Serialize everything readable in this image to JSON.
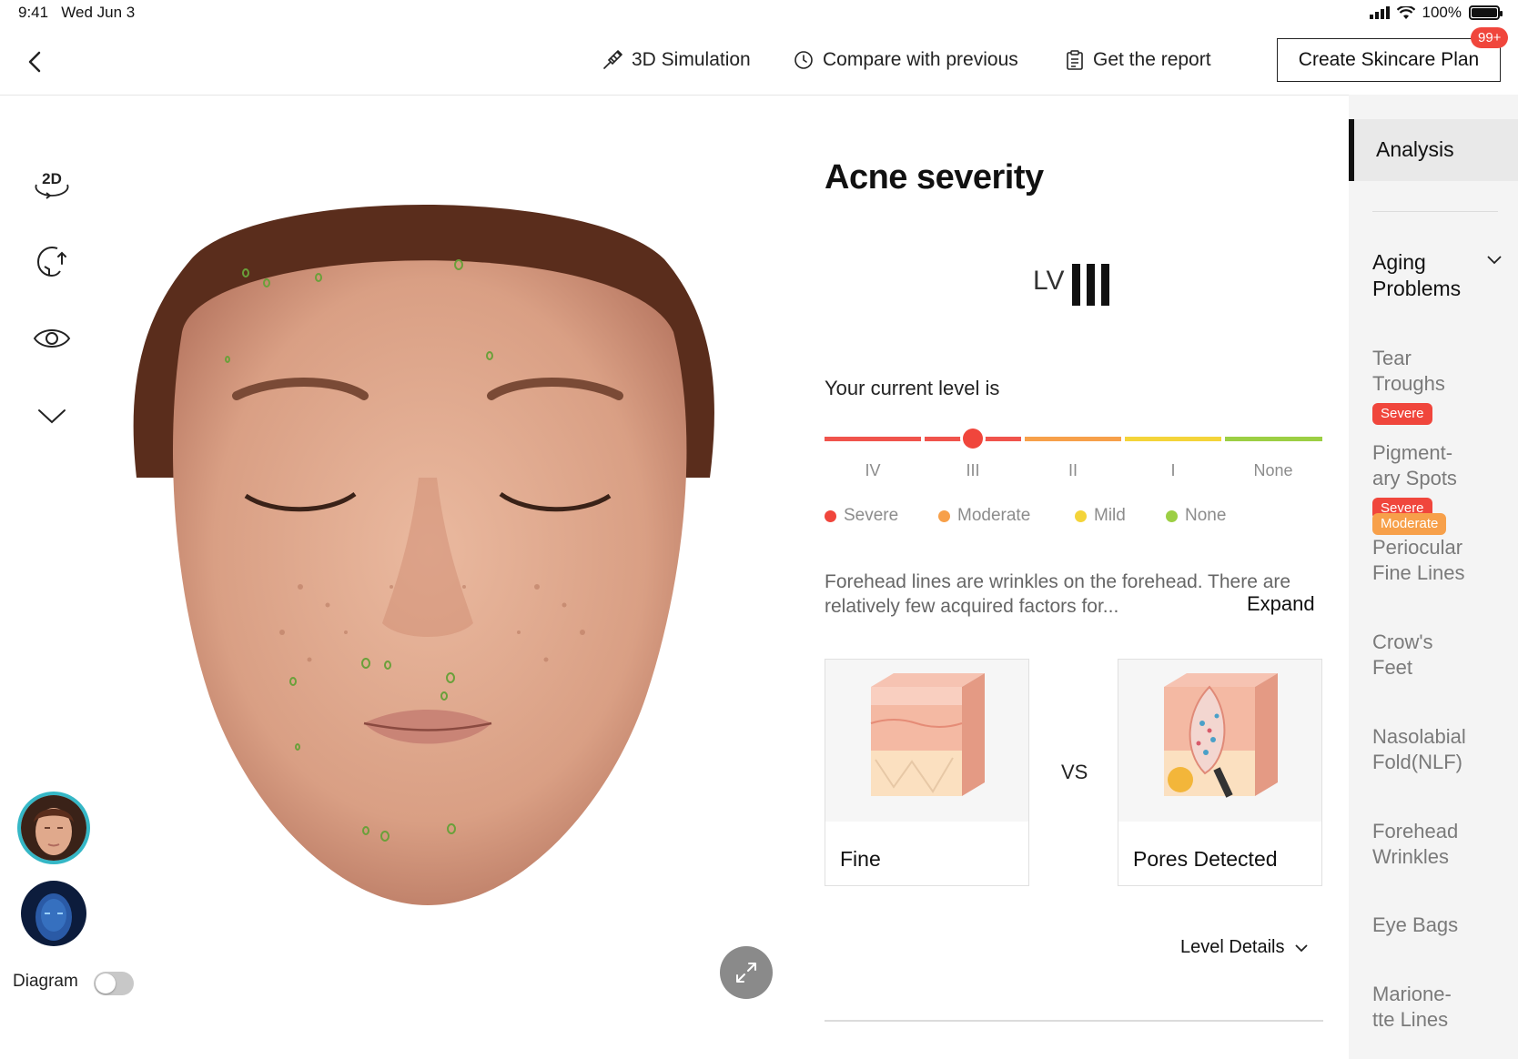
{
  "status": {
    "time": "9:41",
    "date": "Wed Jun 3",
    "battery": "100%",
    "battery_level": 1.0
  },
  "topbar": {
    "simulation_label": "3D Simulation",
    "compare_label": "Compare with previous",
    "report_label": "Get the report",
    "create_label": "Create Skincare Plan",
    "badge": "99+"
  },
  "left_tools": {
    "view_mode_label": "2D",
    "diagram_label": "Diagram",
    "diagram_on": false
  },
  "analysis": {
    "title": "Acne severity",
    "lv_prefix": "LV",
    "level_value": 3,
    "level_label": "Your current level is",
    "scale": [
      {
        "label": "IV",
        "color": "#f0544c"
      },
      {
        "label": "III",
        "color": "#f0544c"
      },
      {
        "label": "II",
        "color": "#f7a04a"
      },
      {
        "label": "I",
        "color": "#f4d43a"
      },
      {
        "label": "None",
        "color": "#9ccf44"
      }
    ],
    "legend": [
      {
        "label": "Severe",
        "color": "#f0463c"
      },
      {
        "label": "Moderate",
        "color": "#f7a04a"
      },
      {
        "label": "Mild",
        "color": "#f4d43a"
      },
      {
        "label": "None",
        "color": "#9ccf44"
      }
    ],
    "description": "Forehead lines are wrinkles on the forehead. There are relatively few acquired factors for...",
    "expand_label": "Expand",
    "card_left_label": "Fine",
    "vs_label": "VS",
    "card_right_label": "Pores Detected",
    "level_details_label": "Level Details"
  },
  "sidebar": {
    "active_tab": "Analysis",
    "group_title": "Aging Problems",
    "items": [
      {
        "label": "Tear Troughs"
      },
      {
        "label": "Pigment-ary Spots"
      },
      {
        "label": "Periocular Fine Lines"
      },
      {
        "label": "Crow's Feet"
      },
      {
        "label": "Nasolabial Fold(NLF)"
      },
      {
        "label": "Forehead Wrinkles"
      },
      {
        "label": "Eye Bags"
      },
      {
        "label": "Marione-tte Lines"
      }
    ],
    "badges": {
      "tear_troughs": {
        "label": "Severe",
        "color": "#f0463c"
      },
      "pigment_1": {
        "label": "Severe",
        "color": "#f0463c"
      },
      "pigment_2": {
        "label": "Moderate",
        "color": "#f7a04a"
      }
    }
  }
}
